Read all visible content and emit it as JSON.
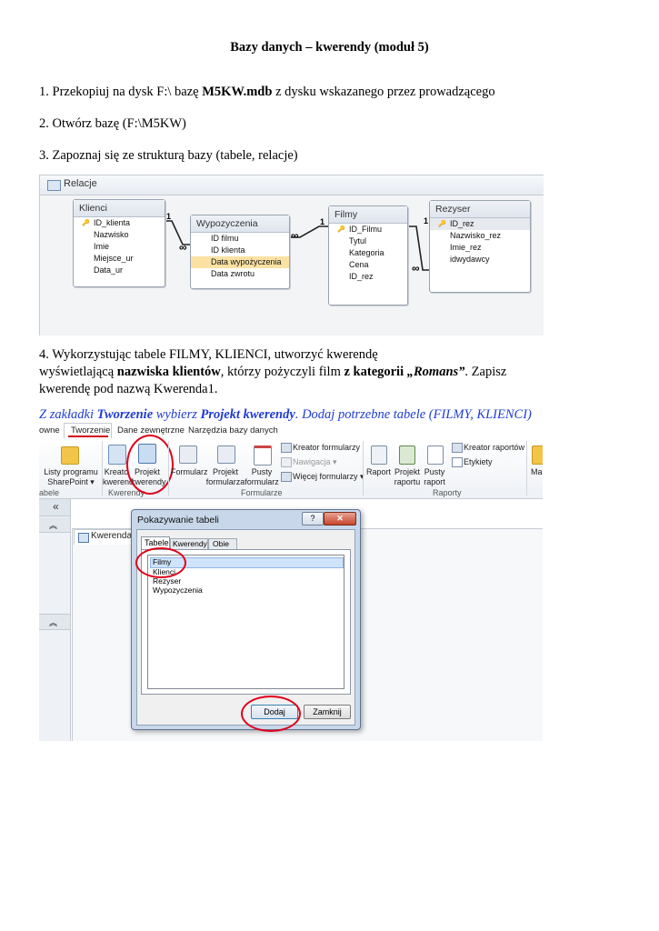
{
  "doc": {
    "title": "Bazy danych – kwerendy (moduł 5)",
    "step1": {
      "pre": "1. Przekopiuj na dysk F:\\ bazę ",
      "bold": "M5KW.mdb",
      "post": " z dysku wskazanego przez prowadzącego"
    },
    "step2": "2. Otwórz bazę (F:\\M5KW)",
    "step3": "3. Zapoznaj się ze strukturą bazy (tabele, relacje)",
    "step4": {
      "l1": "4. Wykorzystując tabele FILMY, KLIENCI, utworzyć kwerendę",
      "l2a": "wyświetlającą ",
      "l2b": "nazwiska klientów",
      "l2c": ", którzy pożyczyli film ",
      "l2d": "z kategorii ",
      "l2e": "„Romans”",
      "l2f": ". Zapisz",
      "l3": "kwerendę pod nazwą Kwerenda1."
    },
    "instr": {
      "a": "Z zakładki ",
      "b": "Tworzenie",
      "c": " wybierz ",
      "d": "Projekt kwerendy",
      "e": ". Dodaj potrzebne tabele (FILMY, KLIENCI)"
    }
  },
  "relations": {
    "window_title": "Relacje",
    "tables": [
      {
        "name": "Klienci",
        "fields": [
          "ID_klienta",
          "Nazwisko",
          "Imie",
          "Miejsce_ur",
          "Data_ur"
        ]
      },
      {
        "name": "Wypozyczenia",
        "fields": [
          "ID filmu",
          "ID klienta",
          "Data wypożyczenia",
          "Data zwrotu"
        ]
      },
      {
        "name": "Filmy",
        "fields": [
          "ID_Filmu",
          "Tytul",
          "Kategoria",
          "Cena",
          "ID_rez"
        ]
      },
      {
        "name": "Rezyser",
        "fields": [
          "ID_rez",
          "Nazwisko_rez",
          "Imie_rez",
          "idwydawcy"
        ]
      }
    ],
    "one": "1",
    "many": "∞"
  },
  "ribbon": {
    "tabs": [
      "owne",
      "Tworzenie",
      "Dane zewnętrzne",
      "Narzędzia bazy danych"
    ],
    "buttons": {
      "lists1": "Listy programu",
      "lists2": "SharePoint ▾",
      "qwiz1": "Kreato",
      "qwiz2": "kwerend",
      "qdes1": "Projekt",
      "qdes2": "kwerendy",
      "form": "Formularz",
      "fdes1": "Projekt",
      "fdes2": "formularza",
      "fblank1": "Pusty",
      "fblank2": "formularz",
      "fwizard": "Kreator formularzy",
      "nav": "Nawigacja ▾",
      "more": "Więcej formularzy ▾",
      "report": "Raport",
      "rdes1": "Projekt",
      "rdes2": "raportu",
      "rblank1": "Pusty",
      "rblank2": "raport",
      "rwizard": "Kreator raportów",
      "labels": "Etykiety",
      "ma": "Ma"
    },
    "groups": {
      "tables": "abele",
      "queries": "Kwerendy",
      "forms": "Formularze",
      "reports": "Raporty"
    }
  },
  "access": {
    "chevrons": "«",
    "query_tab": "Kwerenda1"
  },
  "dialog": {
    "title": "Pokazywanie tabeli",
    "help": "?",
    "close": "✕",
    "tabs": [
      "Tabele",
      "Kwerendy",
      "Obie"
    ],
    "items": [
      "Filmy",
      "Klienci",
      "Rezyser",
      "Wypozyczenia"
    ],
    "add": "Dodaj",
    "closebtn": "Zamknij"
  }
}
